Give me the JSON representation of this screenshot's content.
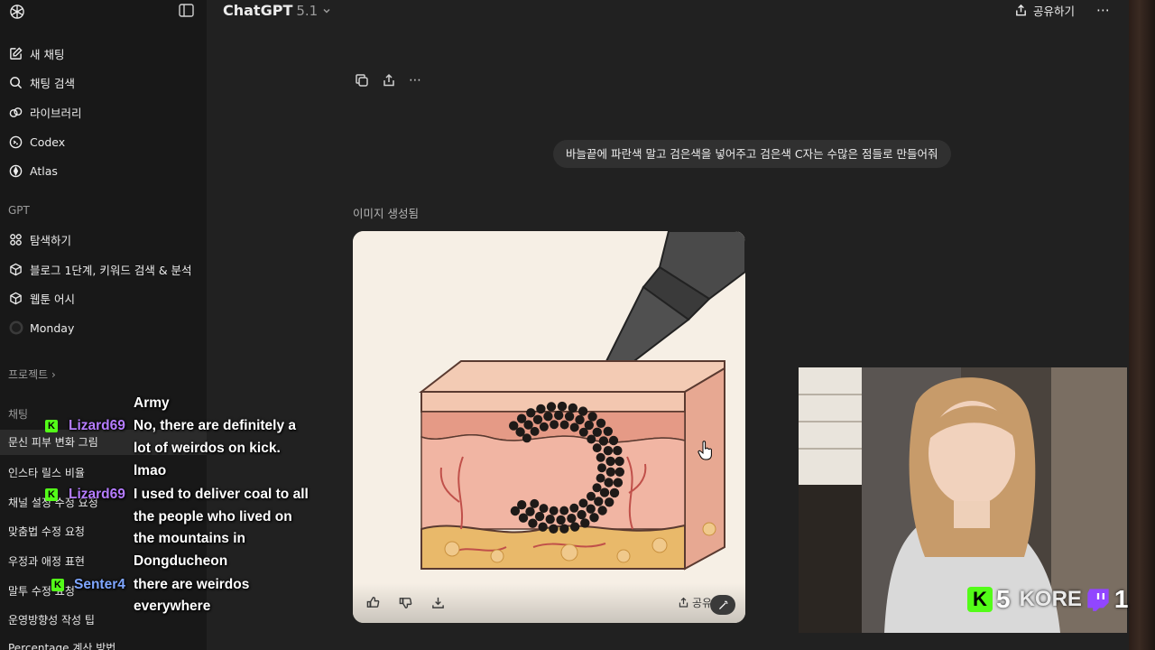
{
  "header": {
    "model_name": "ChatGPT",
    "model_version": "5.1",
    "share_label": "공유하기"
  },
  "sidebar": {
    "new_chat": "새 채팅",
    "search_chat": "채팅 검색",
    "library": "라이브러리",
    "codex": "Codex",
    "atlas": "Atlas",
    "gpt_section": "GPT",
    "explore": "탐색하기",
    "gpt_items": [
      "블로그 1단계, 키워드 검색 & 분석",
      "웹툰 어시",
      "Monday"
    ],
    "projects_section": "프로젝트 ›",
    "chats_section": "채팅",
    "chats": [
      "문신 피부 변화 그림",
      "인스타 릴스 비율",
      "채널 설정 수정 요청",
      "맞춤법 수정 요청",
      "우정과 애정 표현",
      "말투 수정 요청",
      "운영방향성 작성 팁",
      "Percentage 계산 방법"
    ]
  },
  "conversation": {
    "user_message": "바늘끝에 파란색 말고 검은색을 넣어주고 검은색 C자는 수많은 점들로 만들어줘",
    "image_status": "이미지 생성됨",
    "image_share_label": "공유"
  },
  "chat_overlay": {
    "lines": [
      "Army",
      "No, there are definitely a",
      "lot of weirdos on kick.",
      "lmao",
      "I used to deliver coal to all",
      "the people who lived on",
      "the mountains in",
      "Dongducheon",
      "there are weirdos",
      "everywhere"
    ],
    "users": [
      "Lizard69",
      "Lizard69",
      "Senter4"
    ],
    "badge_letter": "K",
    "colors": {
      "lizard": "#b57cff",
      "senter": "#7fa6ff",
      "kick_green": "#53fc18",
      "twitch_purple": "#9146ff"
    }
  },
  "stream_stats": {
    "kick_viewers": "5",
    "twitch_viewers": "1",
    "webcam_shirt_text": "KORE"
  }
}
